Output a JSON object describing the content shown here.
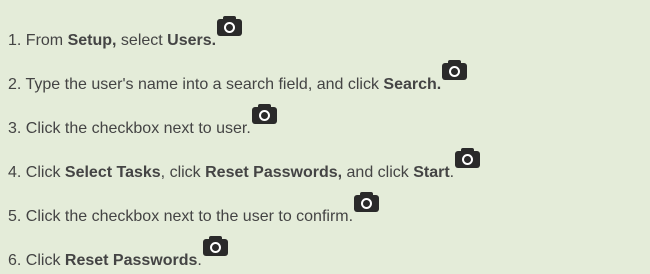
{
  "steps": [
    {
      "number": "1.",
      "parts": [
        {
          "t": "From "
        },
        {
          "t": "Setup,",
          "b": true
        },
        {
          "t": " select "
        },
        {
          "t": "Users.",
          "b": true
        }
      ],
      "icon": "camera-icon"
    },
    {
      "number": "2.",
      "parts": [
        {
          "t": "Type the user's name into a search field, and click "
        },
        {
          "t": "Search.",
          "b": true
        }
      ],
      "icon": "camera-icon"
    },
    {
      "number": "3.",
      "parts": [
        {
          "t": "Click the checkbox next to user."
        }
      ],
      "icon": "camera-icon"
    },
    {
      "number": "4.",
      "parts": [
        {
          "t": "Click "
        },
        {
          "t": "Select Tasks",
          "b": true
        },
        {
          "t": ", click "
        },
        {
          "t": "Reset Passwords,",
          "b": true
        },
        {
          "t": " and click "
        },
        {
          "t": "Start",
          "b": true
        },
        {
          "t": "."
        }
      ],
      "icon": "camera-icon"
    },
    {
      "number": "5.",
      "parts": [
        {
          "t": "Click the checkbox next to the user to confirm."
        }
      ],
      "icon": "camera-icon"
    },
    {
      "number": "6.",
      "parts": [
        {
          "t": "Click "
        },
        {
          "t": "Reset Passwords",
          "b": true
        },
        {
          "t": "."
        }
      ],
      "icon": "camera-icon"
    }
  ],
  "colors": {
    "background": "#e4ecd9",
    "text": "#444444",
    "icon": "#2a2a2a"
  }
}
